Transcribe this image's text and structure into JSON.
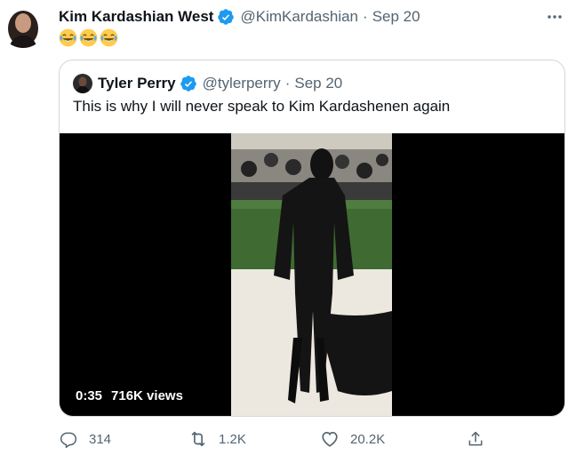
{
  "tweet": {
    "author_name": "Kim Kardashian West",
    "handle": "@KimKardashian",
    "separator": "·",
    "time": "Sep 20",
    "emoji_text": "😂😂😂"
  },
  "quoted": {
    "author_name": "Tyler Perry",
    "handle": "@tylerperry",
    "separator": "·",
    "time": "Sep 20",
    "text": "This is why I will never speak to Kim Kardashenen again",
    "video": {
      "duration": "0:35",
      "views": "716K views"
    }
  },
  "actions": {
    "reply_count": "314",
    "retweet_count": "1.2K",
    "like_count": "20.2K"
  },
  "icons": {
    "verified": "verified-badge-icon",
    "more": "more-icon",
    "reply": "reply-icon",
    "retweet": "retweet-icon",
    "like": "heart-icon",
    "share": "share-icon"
  },
  "colors": {
    "verified": "#1d9bf0",
    "secondary_text": "#536471",
    "border": "#cfd9de"
  }
}
